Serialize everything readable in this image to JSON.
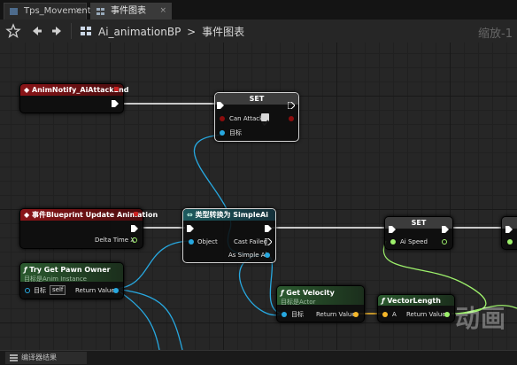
{
  "tabs": [
    {
      "label": "Tps_Movement",
      "close": "×"
    },
    {
      "label": "事件图表",
      "close": "×"
    }
  ],
  "toolbar": {
    "breadcrumb_root": "Ai_animationBP",
    "breadcrumb_sep": ">",
    "breadcrumb_current": "事件图表",
    "zoom": "缩放-1"
  },
  "nodes": {
    "anim_notify": {
      "title": "AnimNotify_AiAttackEnd"
    },
    "set_can_attack": {
      "title": "SET",
      "pin_can_attack": "Can Attack",
      "pin_target": "目标"
    },
    "blueprint_update": {
      "title": "事件Blueprint Update Animation",
      "pin_delta": "Delta Time X"
    },
    "cast": {
      "title": "类型转换为 SimpleAi",
      "pin_object": "Object",
      "pin_cast_failed": "Cast Failed",
      "pin_as": "As Simple Ai"
    },
    "set_ai_speed": {
      "title": "SET",
      "pin_ai_speed": "Ai Speed"
    },
    "try_get_pawn": {
      "title": "Try Get Pawn Owner",
      "subtitle": "目标是Anim Instance",
      "pin_target": "目标",
      "pin_self": "self",
      "pin_return": "Return Value"
    },
    "get_velocity": {
      "title": "Get Velocity",
      "subtitle": "目标是Actor",
      "pin_target": "目标",
      "pin_return": "Return Value"
    },
    "vector_length": {
      "title": "VectorLength",
      "pin_a": "A",
      "pin_return": "Return Value"
    }
  },
  "statusbar": {
    "tab_label": "编译器结果"
  },
  "watermark": "动画",
  "colors": {
    "exec": "#ffffff",
    "bool": "#8c0d0d",
    "object": "#27a8e0",
    "float": "#9df06b",
    "vector": "#f5b72a"
  }
}
